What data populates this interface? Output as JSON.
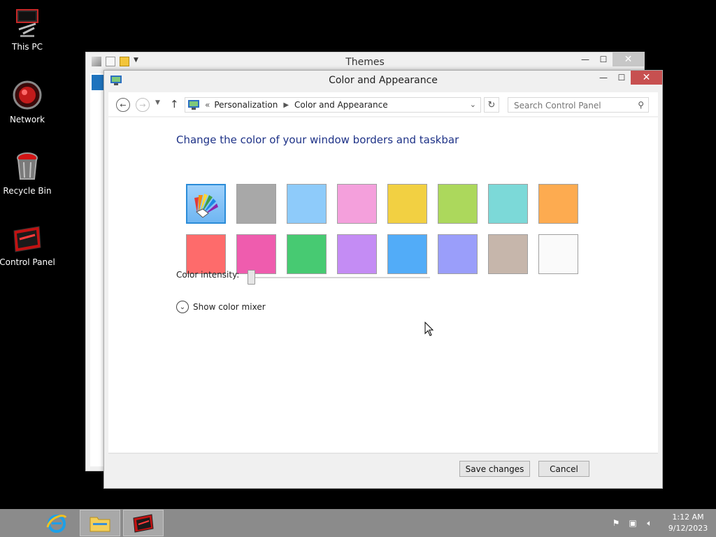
{
  "desktop": {
    "icons": [
      {
        "label": "This PC"
      },
      {
        "label": "Network"
      },
      {
        "label": "Recycle Bin"
      },
      {
        "label": "Control Panel"
      }
    ]
  },
  "themes_window": {
    "title": "Themes"
  },
  "window": {
    "title": "Color and Appearance",
    "breadcrumb": [
      "Personalization",
      "Color and Appearance"
    ],
    "breadcrumb_overflow": "«",
    "search_placeholder": "Search Control Panel"
  },
  "content": {
    "heading": "Change the color of your window borders and taskbar",
    "swatches": [
      {
        "name": "automatic",
        "color": "#8ec5f5",
        "selected": true
      },
      {
        "name": "gray",
        "color": "#a8a8a8"
      },
      {
        "name": "light-blue",
        "color": "#8ecbfa"
      },
      {
        "name": "pink",
        "color": "#f4a0dc"
      },
      {
        "name": "yellow",
        "color": "#f2d042"
      },
      {
        "name": "lime",
        "color": "#acd85c"
      },
      {
        "name": "teal",
        "color": "#7cd9d8"
      },
      {
        "name": "orange",
        "color": "#fdab50"
      },
      {
        "name": "red",
        "color": "#fe6b6b"
      },
      {
        "name": "magenta",
        "color": "#ef5cae"
      },
      {
        "name": "green",
        "color": "#47ca72"
      },
      {
        "name": "purple",
        "color": "#c48cf4"
      },
      {
        "name": "blue",
        "color": "#52acf8"
      },
      {
        "name": "periwinkle",
        "color": "#9a9efa"
      },
      {
        "name": "taupe",
        "color": "#c6b6ab"
      },
      {
        "name": "white",
        "color": "#fafafa"
      }
    ],
    "intensity_label": "Color intensity:",
    "intensity_value": 0,
    "mixer_label": "Show color mixer"
  },
  "footer": {
    "save_label": "Save changes",
    "cancel_label": "Cancel"
  },
  "taskbar": {
    "time": "1:12 AM",
    "date": "9/12/2023"
  }
}
